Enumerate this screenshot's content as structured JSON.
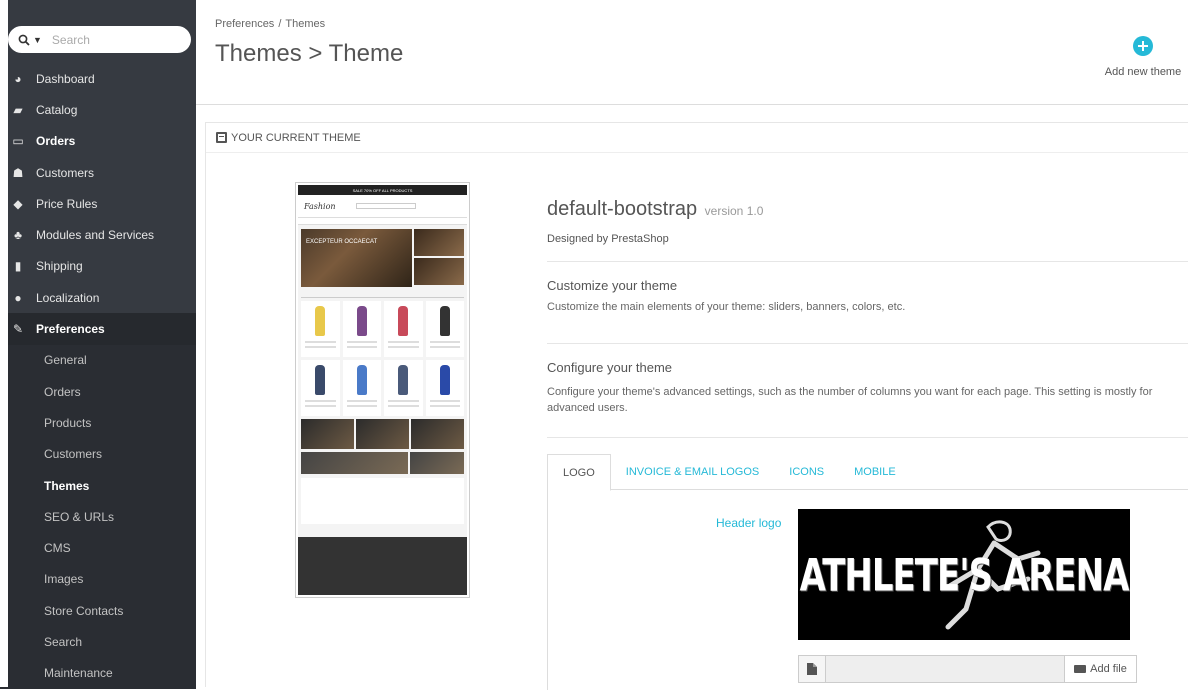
{
  "search": {
    "placeholder": "Search"
  },
  "sidebar": {
    "items": [
      {
        "label": "Dashboard",
        "icon": "dashboard-icon"
      },
      {
        "label": "Catalog",
        "icon": "book-icon"
      },
      {
        "label": "Orders",
        "icon": "credit-card-icon"
      },
      {
        "label": "Customers",
        "icon": "users-icon"
      },
      {
        "label": "Price Rules",
        "icon": "tag-icon"
      },
      {
        "label": "Modules and Services",
        "icon": "puzzle-icon"
      },
      {
        "label": "Shipping",
        "icon": "truck-icon"
      },
      {
        "label": "Localization",
        "icon": "globe-icon"
      },
      {
        "label": "Preferences",
        "icon": "wrench-icon"
      }
    ],
    "submenu": [
      "General",
      "Orders",
      "Products",
      "Customers",
      "Themes",
      "SEO & URLs",
      "CMS",
      "Images",
      "Store Contacts",
      "Search",
      "Maintenance"
    ],
    "active_submenu": "Themes"
  },
  "header": {
    "breadcrumb_1": "Preferences",
    "breadcrumb_sep": "/",
    "breadcrumb_2": "Themes",
    "title": "Themes > Theme",
    "add_label": "Add new theme"
  },
  "panel": {
    "heading": "YOUR CURRENT THEME",
    "theme_name": "default-bootstrap",
    "version": "version 1.0",
    "designed_by": "Designed by PrestaShop",
    "customize_title": "Customize your theme",
    "customize_desc": "Customize the main elements of your theme: sliders, banners, colors, etc.",
    "configure_title": "Configure your theme",
    "configure_desc": "Configure your theme's advanced settings, such as the number of columns you want for each page. This setting is mostly for advanced users."
  },
  "preview": {
    "promo": "SALE 70% OFF ALL PRODUCTS",
    "logo": "Fashion",
    "banner": "EXCEPTEUR OCCAECAT"
  },
  "tabs": [
    "LOGO",
    "INVOICE & EMAIL LOGOS",
    "ICONS",
    "MOBILE"
  ],
  "logo_tab": {
    "header_logo_label": "Header logo",
    "logo_text": "ATHLETE'S ARENA",
    "add_file_label": "Add file"
  },
  "colors": {
    "accent": "#25b9d7",
    "sidebar": "#363a41"
  }
}
